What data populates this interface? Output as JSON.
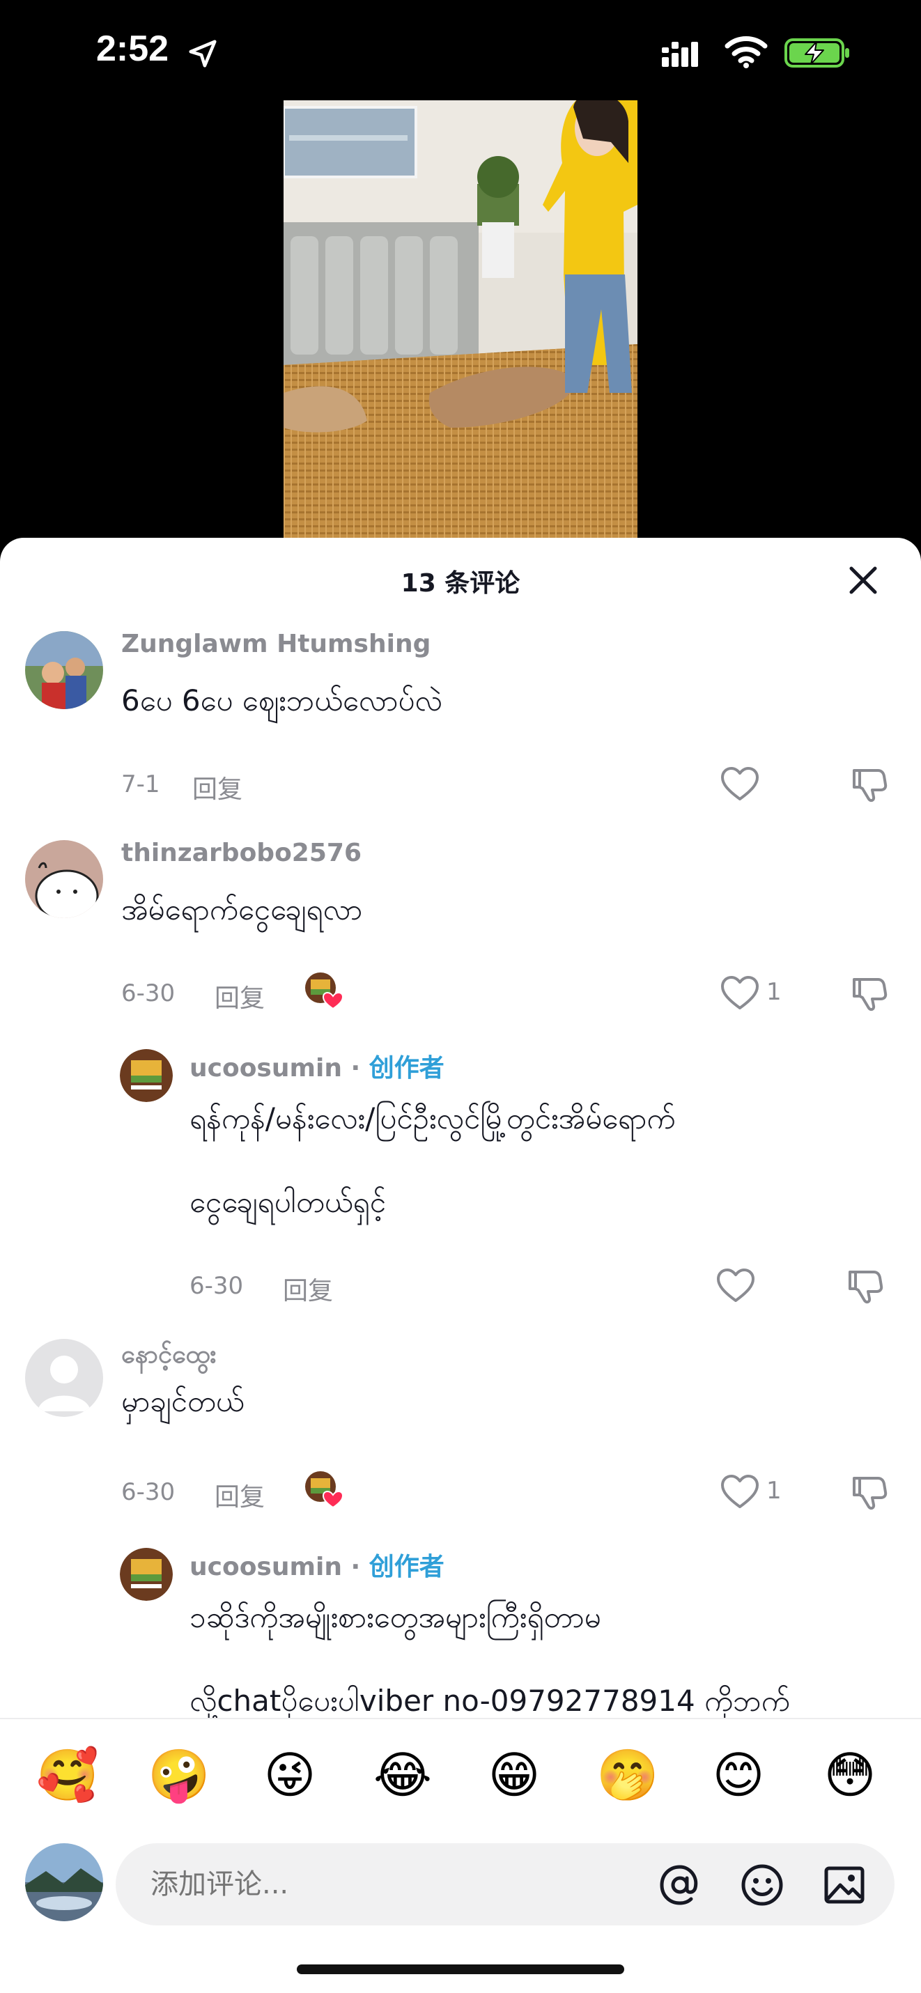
{
  "status_bar": {
    "time": "2:52"
  },
  "sheet": {
    "title": "13 条评论"
  },
  "comments": [
    {
      "username": "Zunglawm Htumshing",
      "text": "6ပေ 6ပေ ဈေးဘယ်လောပ်လဲ",
      "date": "7-1",
      "reply": "回复",
      "likes": ""
    },
    {
      "username": "thinzarbobo2576",
      "text": "အိမ်ရောက်ငွေချေရလာ",
      "date": "6-30",
      "reply": "回复",
      "likes": "1"
    },
    {
      "username": "ucoosumin",
      "separator": "·",
      "creator_tag": "创作者",
      "text_line1": "ရန်ကုန်/မန်းလေး/ပြင်ဦးလွင်မြို့တွင်းအိမ်ရောက်",
      "text_line2": "ငွေချေရပါတယ်ရှင့်",
      "date": "6-30",
      "reply": "回复",
      "likes": ""
    },
    {
      "username": "နောင့်ထွေး",
      "text": "မှာချင်တယ်",
      "date": "6-30",
      "reply": "回复",
      "likes": "1"
    },
    {
      "username": "ucoosumin",
      "separator": "·",
      "creator_tag": "创作者",
      "text_line1": "၁ဆိုဒ်ကိုအမျိုးစားတွေအများကြီးရှိတာမ",
      "text_line2": "လို့chatပိုပေးပါviber no-09792778914 ကိုဘက်"
    }
  ],
  "emoji_bar": [
    "🥰",
    "🤪",
    "😜",
    "😂",
    "😁",
    "🤭",
    "😊",
    "😳"
  ],
  "composer": {
    "placeholder": "添加评论..."
  },
  "colors": {
    "creator_tag": "#2f9fd8",
    "like_badge": "#fe2c55",
    "secondary_text": "#8a8b91"
  }
}
